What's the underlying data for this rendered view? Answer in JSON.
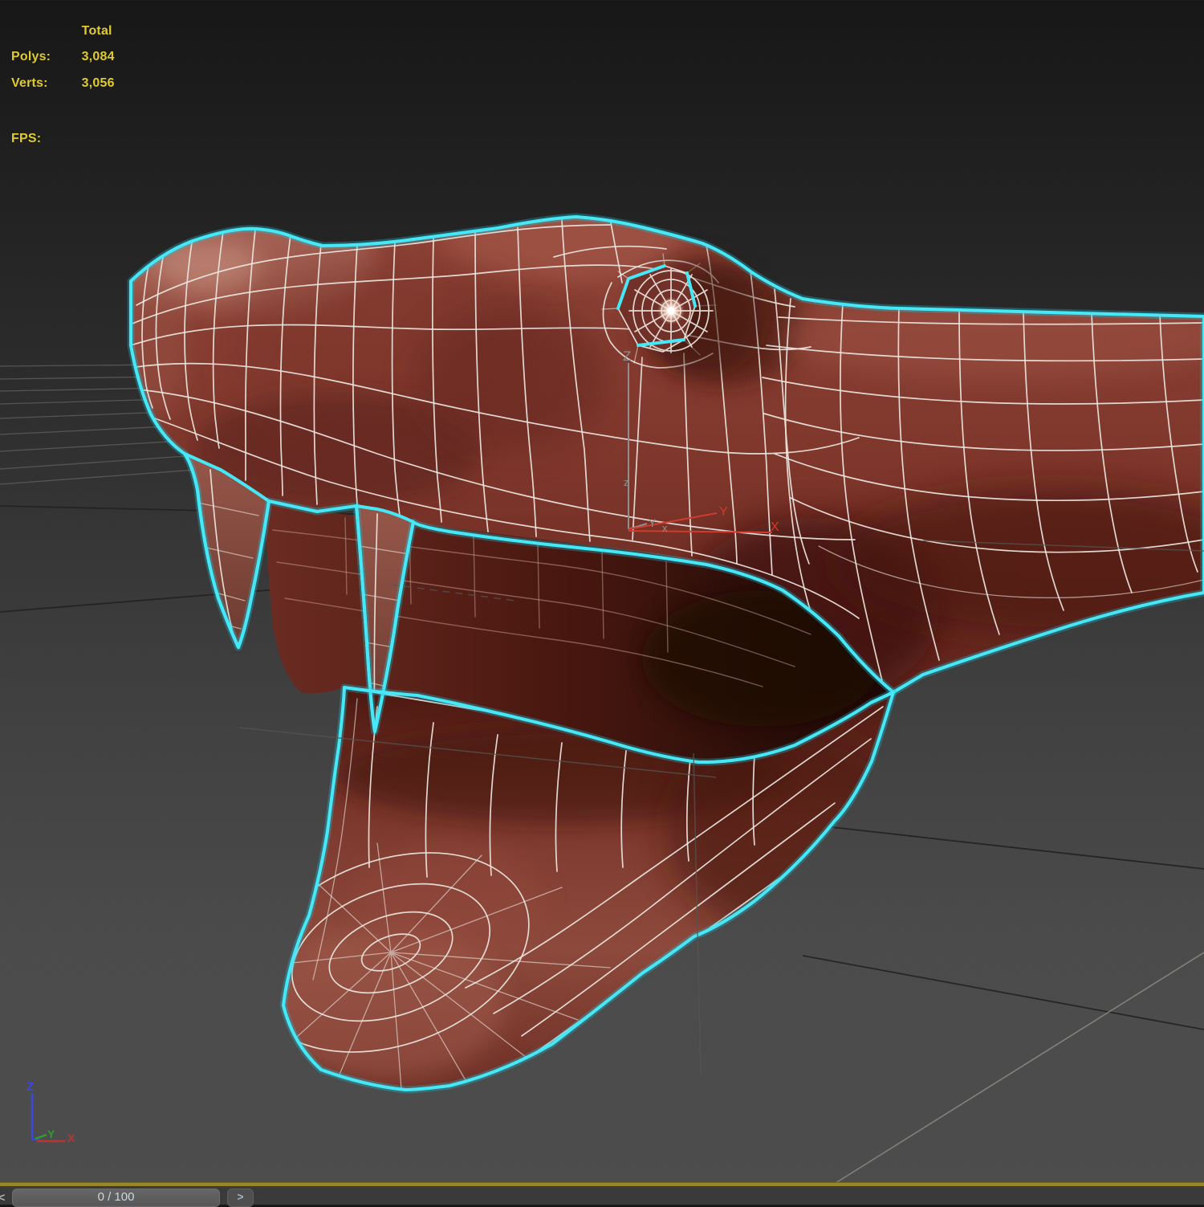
{
  "viewport": {
    "stats": {
      "total_header": "Total",
      "rows": [
        {
          "label": "Polys:",
          "value": "3,084"
        },
        {
          "label": "Verts:",
          "value": "3,056"
        }
      ],
      "fps_label": "FPS:"
    },
    "gizmo": {
      "z_label": "Z",
      "z_minor_label": "z",
      "y_minor_label": "Y",
      "x_minor_label": "x",
      "y_label": "Y",
      "x_label": "X"
    },
    "axis_tripod": {
      "x_label": "X",
      "y_label": "Y",
      "z_label": "Z"
    },
    "colors": {
      "background_top": "#171717",
      "background_bottom": "#4d4d4d",
      "selection_outline": "#46e8f8",
      "wireframe": "#ece6e0",
      "mesh_base": "#83392f",
      "mesh_highlight": "#b5786a",
      "mesh_shadow": "#41150f",
      "stats_text": "#decb2e",
      "grid_line": "#5d5c59",
      "gizmo_gray": "#8f8f8f",
      "gizmo_red": "#d23a2e",
      "axis_x": "#b93535",
      "axis_y": "#2f9e2f",
      "axis_z": "#3c47e0",
      "timeline_rule": "#98872a",
      "timeline_bar": "#3a3a3a",
      "timeline_text": "#cdd7de"
    }
  },
  "timeline": {
    "frame_indicator": "0 / 100",
    "prev_label": "<",
    "next_label": ">"
  }
}
